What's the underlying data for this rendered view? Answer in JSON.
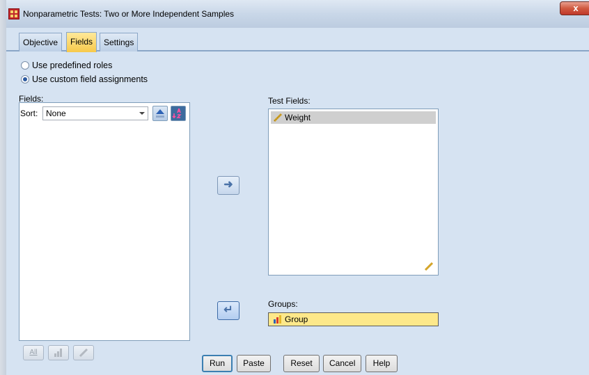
{
  "window": {
    "title": "Nonparametric Tests: Two or More Independent Samples",
    "close_glyph": "x"
  },
  "tabs": [
    {
      "label": "Objective",
      "active": false
    },
    {
      "label": "Fields",
      "active": true
    },
    {
      "label": "Settings",
      "active": false
    }
  ],
  "roles": {
    "option_predefined": {
      "label": "Use predefined roles",
      "selected": false
    },
    "option_custom": {
      "label": "Use custom field assignments",
      "selected": true
    }
  },
  "fields_panel": {
    "heading": "Fields:",
    "sort_label": "Sort:",
    "sort_value": "None",
    "tool_all": "All"
  },
  "test_fields": {
    "heading": "Test Fields:",
    "items": [
      "Weight"
    ]
  },
  "groups": {
    "heading": "Groups:",
    "value": "Group"
  },
  "buttons": {
    "run": "Run",
    "paste": "Paste",
    "reset": "Reset",
    "cancel": "Cancel",
    "help": "Help"
  },
  "colors": {
    "dialog_bg": "#d6e3f2",
    "active_tab": "#f7c94a",
    "groups_field": "#fde88a"
  },
  "icons": [
    "spss-icon",
    "close-icon",
    "chevron-down-icon",
    "sort-up-icon",
    "sort-alpha-icon",
    "scale-measure-icon",
    "nominal-bar-icon",
    "arrow-right-icon",
    "arrow-left-icon",
    "pencil-icon"
  ]
}
